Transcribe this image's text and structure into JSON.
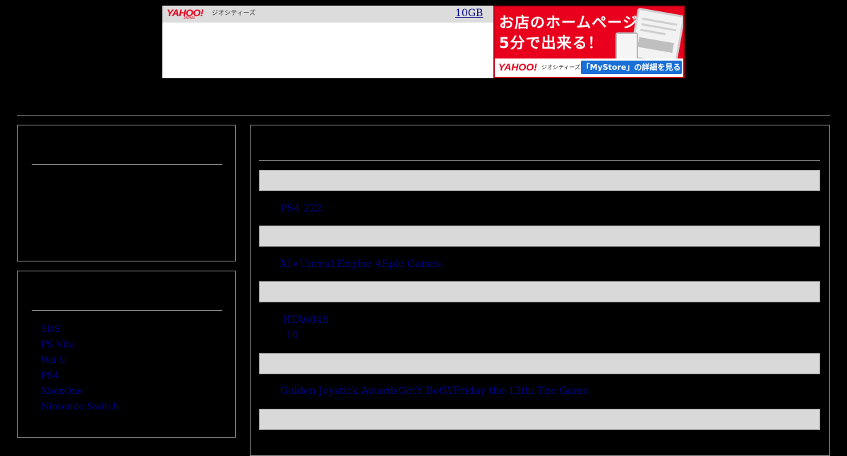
{
  "ad": {
    "logo": "YAHOO!",
    "logo_sub": "JAPAN",
    "brand": "ジオシティーズ",
    "storage_link": "10GB",
    "headline_line1": "お店のホームページが",
    "headline_line2": "5分で出来る！",
    "footer_logo": "YAHOO!",
    "footer_brand": "ジオシティーズ",
    "cta_label": "「MyStore」の詳細を見る",
    "accent_color": "#e8001c",
    "cta_color": "#1a6fd6"
  },
  "sidebar": {
    "platforms": [
      "3DS",
      "PS Vita",
      "Wii U",
      "PS4",
      "XboxOne",
      "Nintendo Switch"
    ]
  },
  "posts": [
    {
      "text": "PS4 222"
    },
    {
      "text": "XI×Unreal Engine 4Epic Games"
    },
    {
      "text": "RTA6848",
      "extra": "10"
    },
    {
      "text": "Golden Joystick AwardsGotY BotWFriday the 13th: The Game"
    }
  ],
  "colors": {
    "background": "#000000",
    "link": "#00008b",
    "post_bar": "#d9d9d9",
    "border": "#8a8a8a"
  }
}
